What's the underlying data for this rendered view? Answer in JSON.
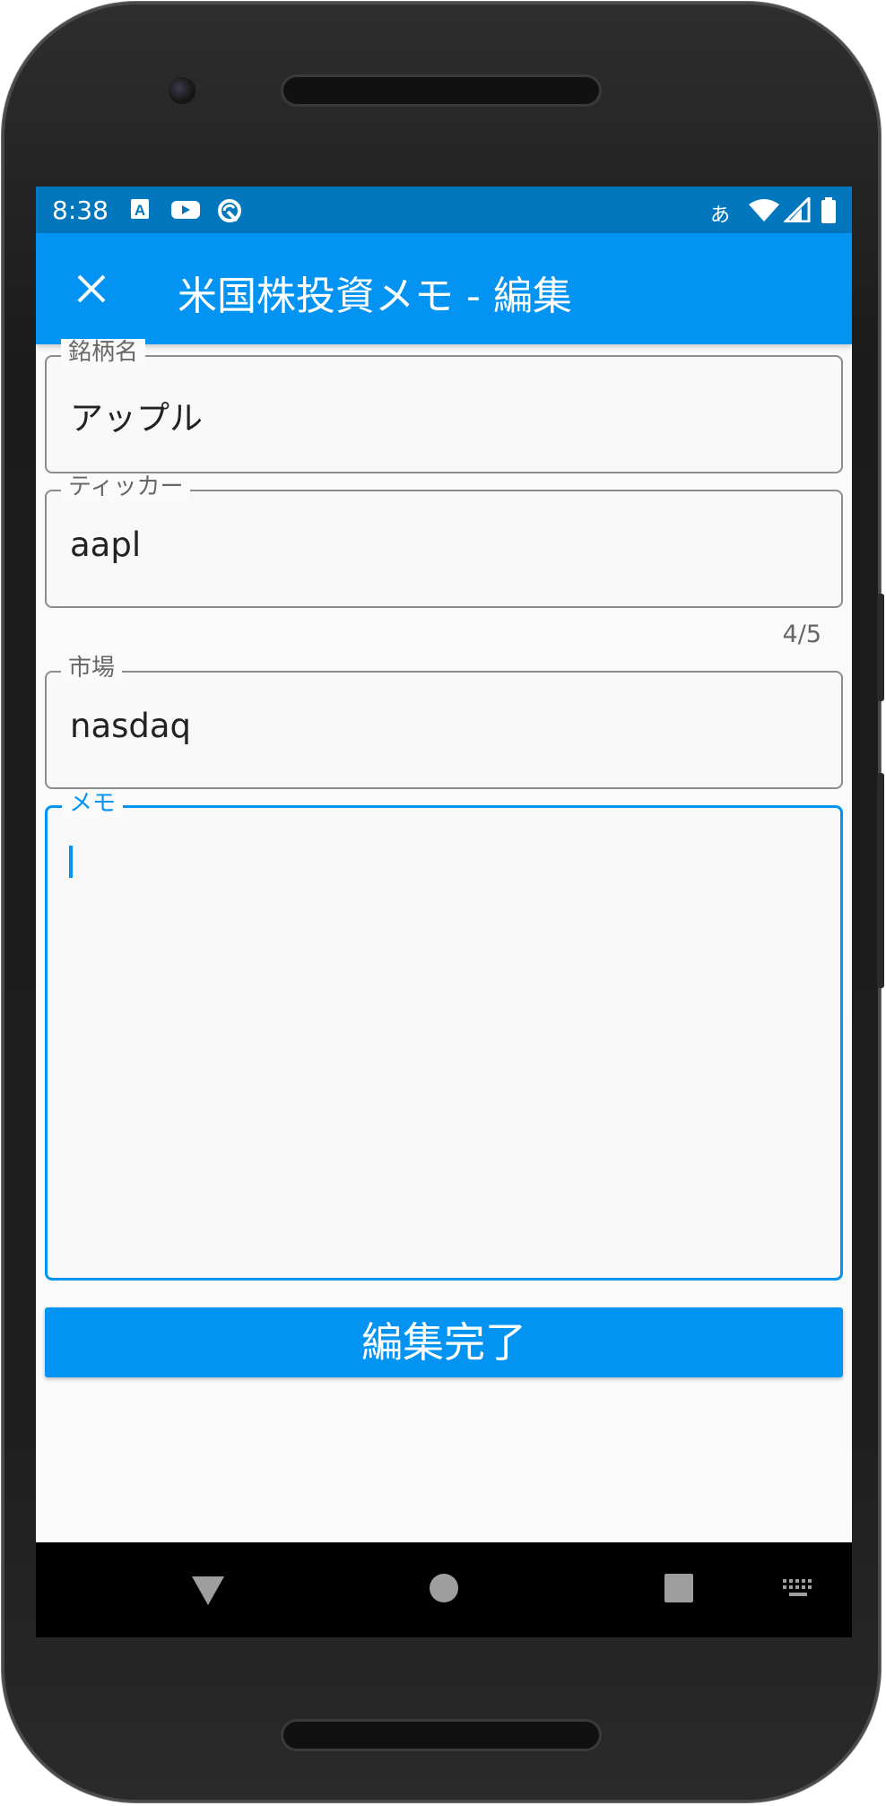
{
  "status_bar": {
    "time": "8:38",
    "ime_indicator": "あ",
    "icons": [
      "a-keyboard-icon",
      "youtube-icon",
      "sync-icon",
      "wifi-icon",
      "signal-icon",
      "battery-icon"
    ]
  },
  "app_bar": {
    "title": "米国株投資メモ - 編集",
    "close_icon": "close-icon"
  },
  "form": {
    "name": {
      "label": "銘柄名",
      "value": "アップル"
    },
    "ticker": {
      "label": "ティッカー",
      "value": "aapl",
      "counter": "4/5"
    },
    "market": {
      "label": "市場",
      "value": "nasdaq"
    },
    "memo": {
      "label": "メモ",
      "value": ""
    }
  },
  "submit_label": "編集完了",
  "nav_bar": {
    "icons": [
      "back-icon",
      "home-icon",
      "recents-icon",
      "keyboard-icon"
    ]
  },
  "colors": {
    "status_bar": "#0277bd",
    "app_bar": "#0394f3",
    "accent": "#0394f3",
    "background": "#fafafa"
  }
}
